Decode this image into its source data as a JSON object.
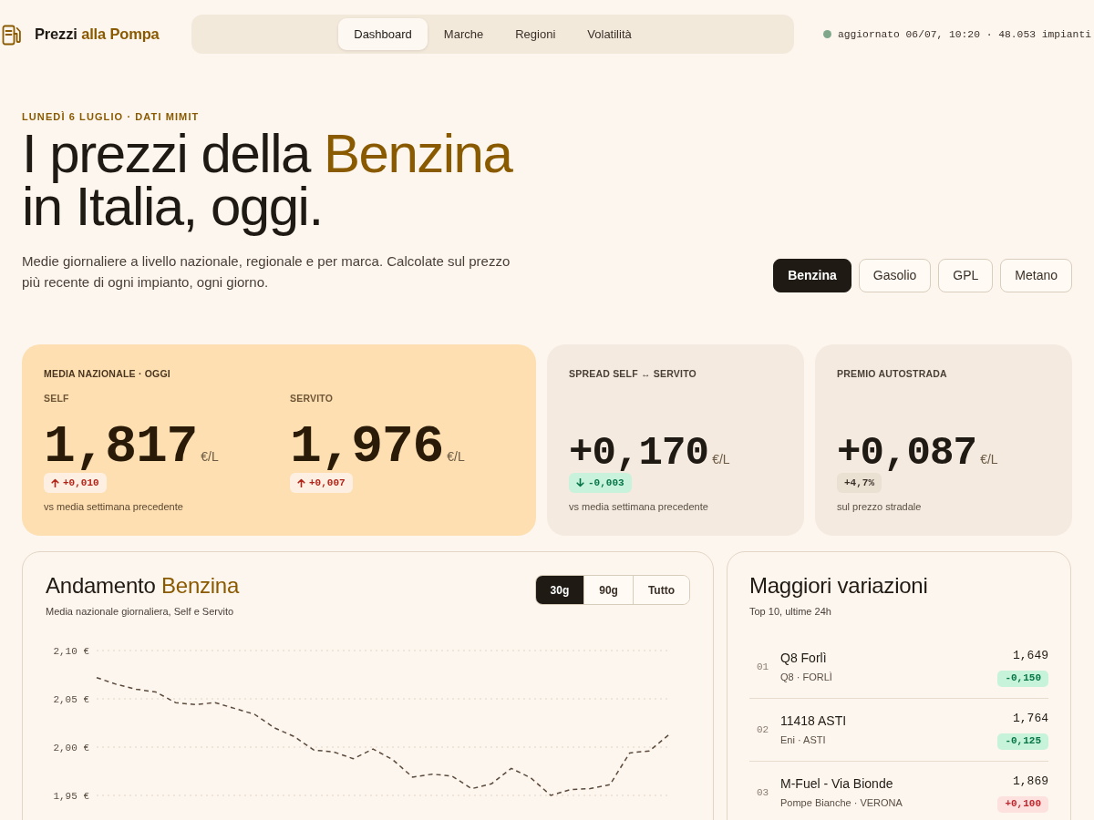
{
  "brand": [
    {
      "text": "Prezzi ",
      "accent": false
    },
    {
      "text": "alla Pompa",
      "accent": true
    }
  ],
  "nav": [
    {
      "label": "Dashboard",
      "selected": true
    },
    {
      "label": "Marche",
      "selected": false
    },
    {
      "label": "Regioni",
      "selected": false
    },
    {
      "label": "Volatilità",
      "selected": false
    }
  ],
  "status": {
    "text": "aggiornato 06/07, 10:20 · 48.053 impianti"
  },
  "hero": {
    "eyebrow": "LUNEDÌ 6 LUGLIO · DATI MIMIT",
    "title": [
      {
        "text": "I prezzi della ",
        "accent": false
      },
      {
        "text": "Benzina",
        "accent": true
      },
      {
        "text": " in Italia, oggi.",
        "accent": false
      }
    ],
    "subtitle": "Medie giornaliere a livello nazionale, regionale e per marca. Calcolate sul prezzo più recente di ogni impianto, ogni giorno."
  },
  "fuel_tabs": [
    {
      "label": "Benzina",
      "selected": true
    },
    {
      "label": "Gasolio",
      "selected": false
    },
    {
      "label": "GPL",
      "selected": false
    },
    {
      "label": "Metano",
      "selected": false
    }
  ],
  "stats": {
    "national": {
      "label": "MEDIA NAZIONALE · OGGI",
      "columns": [
        {
          "label": "SELF",
          "value": "1,817",
          "unit": "€/L",
          "change": "+0,010",
          "kind": "increase",
          "note": "vs media settimana precedente"
        },
        {
          "label": "SERVITO",
          "value": "1,976",
          "unit": "€/L",
          "change": "+0,007",
          "kind": "increase"
        }
      ]
    },
    "cards": [
      {
        "label": "SPREAD SELF ↔ SERVITO",
        "value": "+0,170",
        "unit": "€/L",
        "change": "-0,003",
        "kind": "decrease",
        "note": "vs media settimana precedente"
      },
      {
        "label": "PREMIO AUTOSTRADA",
        "value": "+0,087",
        "unit": "€/L",
        "change": "+4,7%",
        "kind": "neutral",
        "note": "sul prezzo stradale"
      }
    ]
  },
  "trend_chart": {
    "title": [
      {
        "text": "Andamento ",
        "accent": false
      },
      {
        "text": "Benzina",
        "accent": true
      }
    ],
    "subtitle": "Media nazionale giornaliera, Self e Servito",
    "ranges": [
      {
        "label": "30g",
        "selected": true
      },
      {
        "label": "90g",
        "selected": false
      },
      {
        "label": "Tutto",
        "selected": false
      }
    ],
    "chart_data": {
      "type": "line",
      "grid": true,
      "ylim": [
        1.95,
        2.1
      ],
      "yticks": [
        {
          "value": 2.1,
          "label": "2,10 €"
        },
        {
          "value": 2.05,
          "label": "2,05 €"
        },
        {
          "value": 2.0,
          "label": "2,00 €"
        },
        {
          "value": 1.95,
          "label": "1,95 €"
        }
      ],
      "series": [
        {
          "color": "#5b4a3b",
          "line_style": "dashed",
          "values": [
            2.072,
            2.065,
            2.06,
            2.057,
            2.046,
            2.044,
            2.046,
            2.04,
            2.034,
            2.02,
            2.011,
            1.997,
            1.995,
            1.988,
            1.998,
            1.987,
            1.969,
            1.972,
            1.97,
            1.957,
            1.962,
            1.978,
            1.968,
            1.95,
            1.956,
            1.957,
            1.961,
            1.994,
            1.996,
            2.013
          ]
        }
      ]
    }
  },
  "movers": {
    "title": "Maggiori variazioni",
    "subtitle": "Top 10, ultime 24h",
    "rows": [
      {
        "rank": "01",
        "name": "Q8 Forlì",
        "detail": "Q8 · FORLÌ",
        "price": "1,649",
        "change": "-0,150",
        "kind": "decrease"
      },
      {
        "rank": "02",
        "name": "11418 ASTI",
        "detail": "Eni · ASTI",
        "price": "1,764",
        "change": "-0,125",
        "kind": "decrease"
      },
      {
        "rank": "03",
        "name": "M-Fuel - Via Bionde",
        "detail": "Pompe Bianche · VERONA",
        "price": "1,869",
        "change": "+0,100",
        "kind": "increase"
      }
    ]
  }
}
